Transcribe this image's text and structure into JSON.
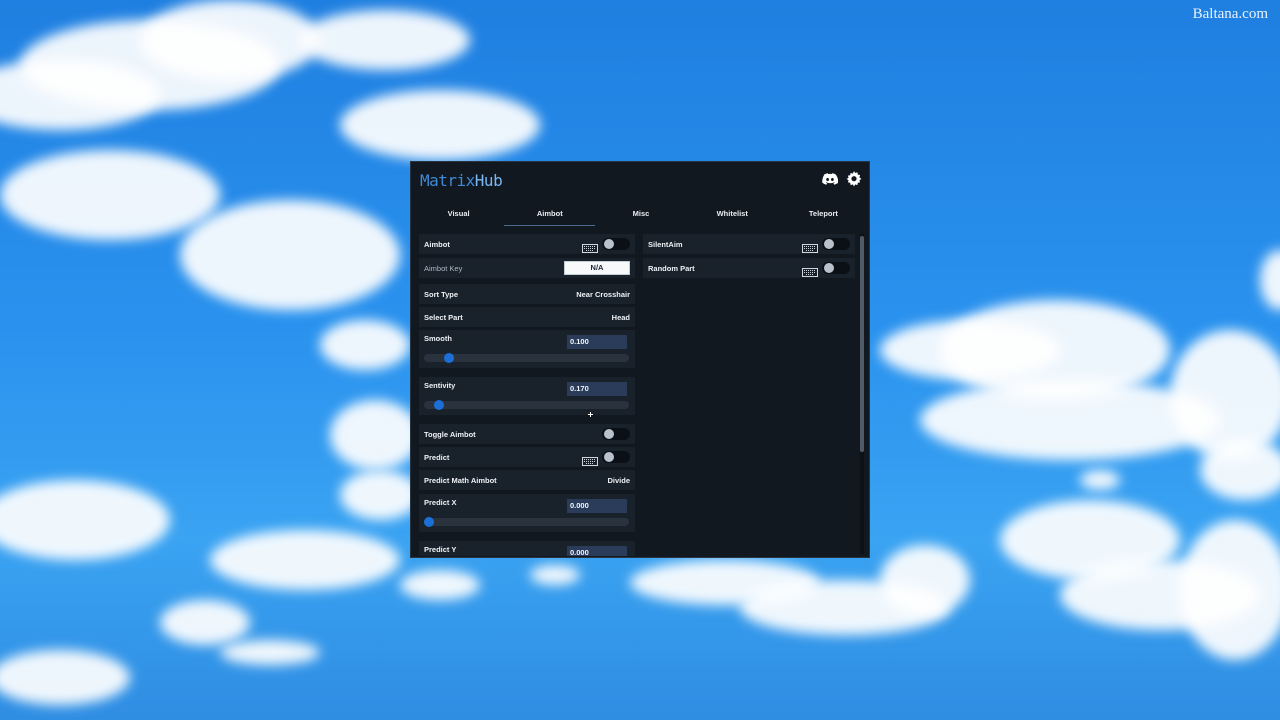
{
  "watermark": "Baltana.com",
  "window": {
    "title_part1": "Matrix",
    "title_part2": "Hub"
  },
  "icons": {
    "discord": "discord-icon",
    "settings": "gear-icon"
  },
  "tabs": [
    {
      "label": "Visual",
      "active": false
    },
    {
      "label": "Aimbot",
      "active": true
    },
    {
      "label": "Misc",
      "active": false
    },
    {
      "label": "Whitelist",
      "active": false
    },
    {
      "label": "Teleport",
      "active": false
    }
  ],
  "left": {
    "aimbot": {
      "label": "Aimbot",
      "enabled": false
    },
    "aimbot_key": {
      "label": "Aimbot Key",
      "value": "N/A"
    },
    "sort_type": {
      "label": "Sort Type",
      "value": "Near Crosshair"
    },
    "select_part": {
      "label": "Select Part",
      "value": "Head"
    },
    "smooth": {
      "label": "Smooth",
      "value": "0.100",
      "fraction": 0.1
    },
    "sentivity": {
      "label": "Sentivity",
      "value": "0.170",
      "fraction": 0.05
    },
    "toggle_aimbot": {
      "label": "Toggle Aimbot",
      "enabled": false
    },
    "predict": {
      "label": "Predict",
      "enabled": false
    },
    "predict_math": {
      "label": "Predict Math Aimbot",
      "value": "Divide"
    },
    "predict_x": {
      "label": "Predict X",
      "value": "0.000",
      "fraction": 0
    },
    "predict_y": {
      "label": "Predict Y",
      "value": "0.000"
    }
  },
  "right": {
    "silent_aim": {
      "label": "SilentAim",
      "enabled": false
    },
    "random_part": {
      "label": "Random Part",
      "enabled": false
    }
  },
  "colors": {
    "accent": "#1b6fd6",
    "panel": "#111820",
    "row": "#19212b"
  }
}
